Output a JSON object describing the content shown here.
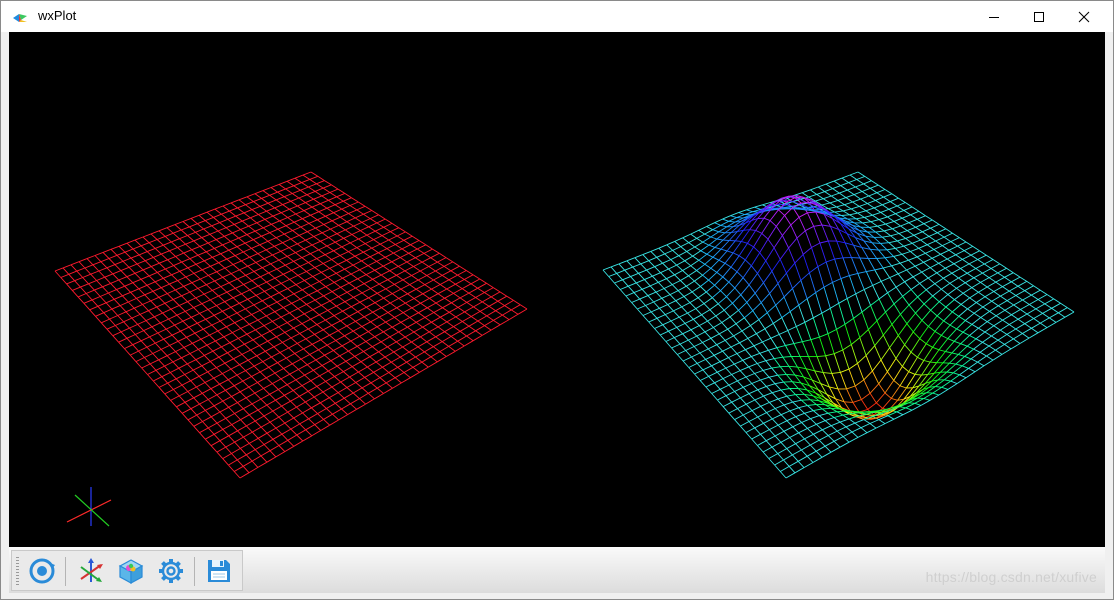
{
  "window": {
    "title": "wxPlot",
    "controls": {
      "minimize_icon": "minimize-icon",
      "maximize_icon": "maximize-icon",
      "close_icon": "close-icon"
    }
  },
  "canvas": {
    "background": "#000000",
    "plots": [
      {
        "name": "flat-surface",
        "color": "#ff1a2e",
        "grid": 32
      },
      {
        "name": "wave-surface",
        "base_color": "#39e6e6",
        "grid": 32
      }
    ],
    "axes_triad_colors": {
      "x": "#ff2020",
      "y": "#20d020",
      "z": "#2020ff"
    }
  },
  "toolbar": {
    "buttons": [
      {
        "name": "rotate-view-button",
        "icon": "rotate-icon"
      },
      {
        "name": "axes-button",
        "icon": "axes-icon"
      },
      {
        "name": "box-view-button",
        "icon": "cube-icon"
      },
      {
        "name": "settings-button",
        "icon": "gear-icon"
      },
      {
        "name": "save-button",
        "icon": "save-icon"
      }
    ]
  },
  "watermark": "https://blog.csdn.net/xufive"
}
